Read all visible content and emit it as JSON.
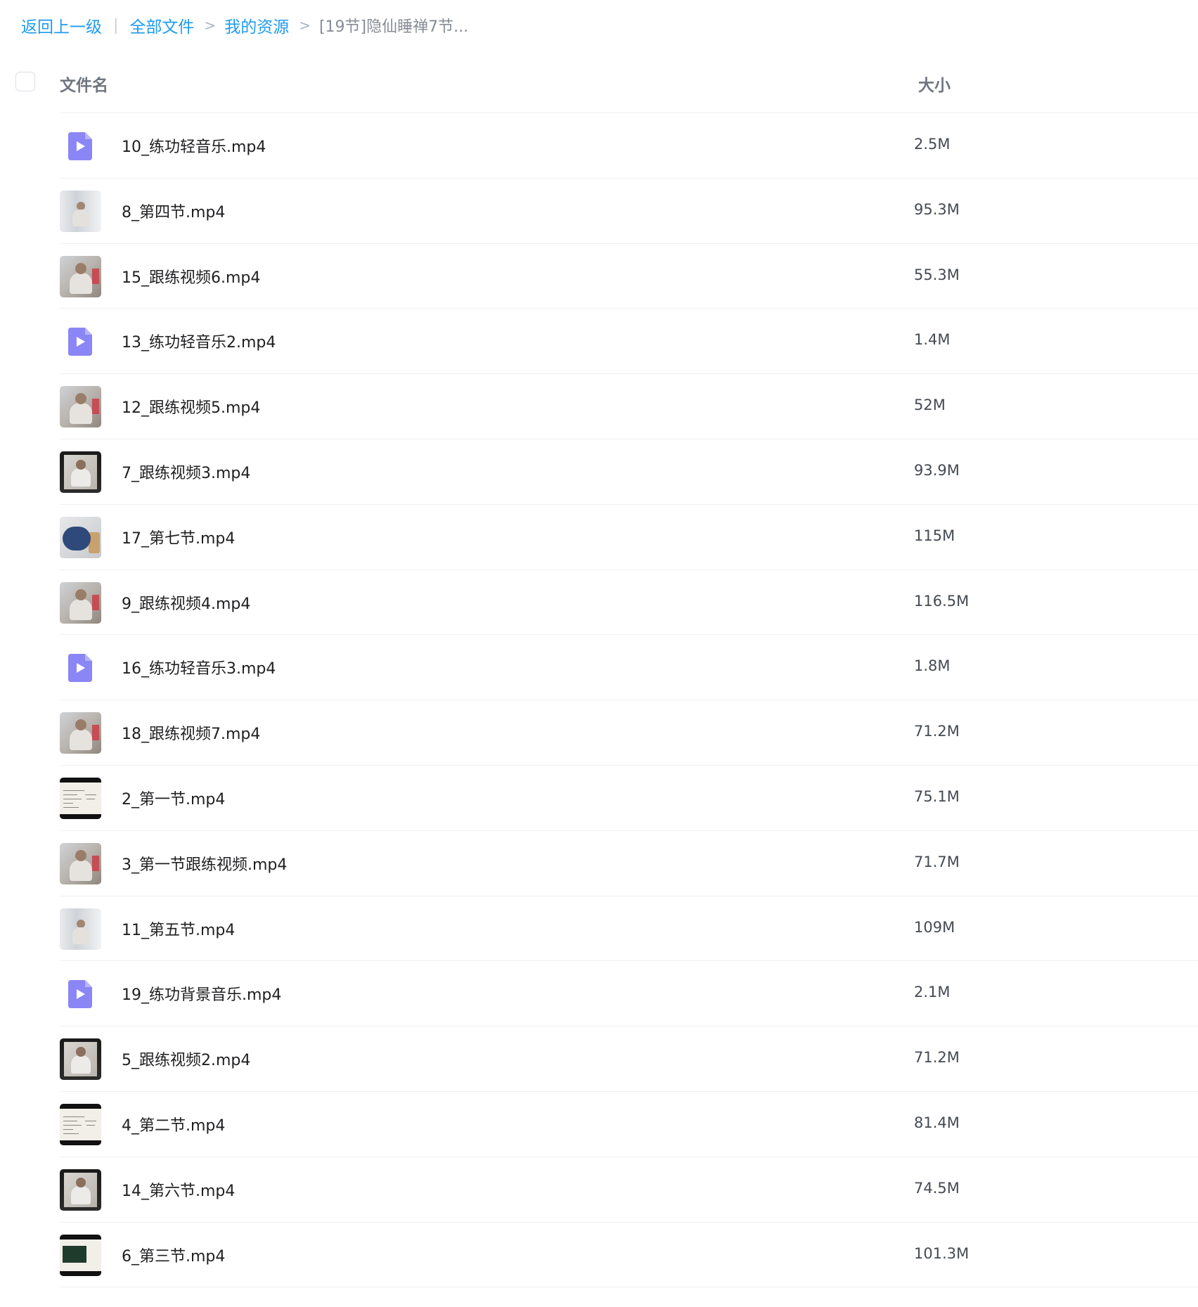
{
  "breadcrumb": {
    "back": "返回上一级",
    "bar": "|",
    "all_files": "全部文件",
    "sep": ">",
    "my_resources": "我的资源",
    "current": "[19节]隐仙睡禅7节..."
  },
  "header": {
    "name": "文件名",
    "size": "大小"
  },
  "files": [
    {
      "name": "10_练功轻音乐.mp4",
      "size": "2.5M",
      "thumb": "video-file-icon"
    },
    {
      "name": "8_第四节.mp4",
      "size": "95.3M",
      "thumb": "light"
    },
    {
      "name": "15_跟练视频6.mp4",
      "size": "55.3M",
      "thumb": "person"
    },
    {
      "name": "13_练功轻音乐2.mp4",
      "size": "1.4M",
      "thumb": "video-file-icon"
    },
    {
      "name": "12_跟练视频5.mp4",
      "size": "52M",
      "thumb": "person"
    },
    {
      "name": "7_跟练视频3.mp4",
      "size": "93.9M",
      "thumb": "dark"
    },
    {
      "name": "17_第七节.mp4",
      "size": "115M",
      "thumb": "blue"
    },
    {
      "name": "9_跟练视频4.mp4",
      "size": "116.5M",
      "thumb": "person"
    },
    {
      "name": "16_练功轻音乐3.mp4",
      "size": "1.8M",
      "thumb": "video-file-icon"
    },
    {
      "name": "18_跟练视频7.mp4",
      "size": "71.2M",
      "thumb": "person"
    },
    {
      "name": "2_第一节.mp4",
      "size": "75.1M",
      "thumb": "slide"
    },
    {
      "name": "3_第一节跟练视频.mp4",
      "size": "71.7M",
      "thumb": "person"
    },
    {
      "name": "11_第五节.mp4",
      "size": "109M",
      "thumb": "light"
    },
    {
      "name": "19_练功背景音乐.mp4",
      "size": "2.1M",
      "thumb": "video-file-icon"
    },
    {
      "name": "5_跟练视频2.mp4",
      "size": "71.2M",
      "thumb": "dark"
    },
    {
      "name": "4_第二节.mp4",
      "size": "81.4M",
      "thumb": "slide"
    },
    {
      "name": "14_第六节.mp4",
      "size": "74.5M",
      "thumb": "dark"
    },
    {
      "name": "6_第三节.mp4",
      "size": "101.3M",
      "thumb": "board"
    }
  ],
  "colors": {
    "link": "#1e9bf0",
    "video_icon": "#8b86f5",
    "divider": "#eef0f3"
  }
}
